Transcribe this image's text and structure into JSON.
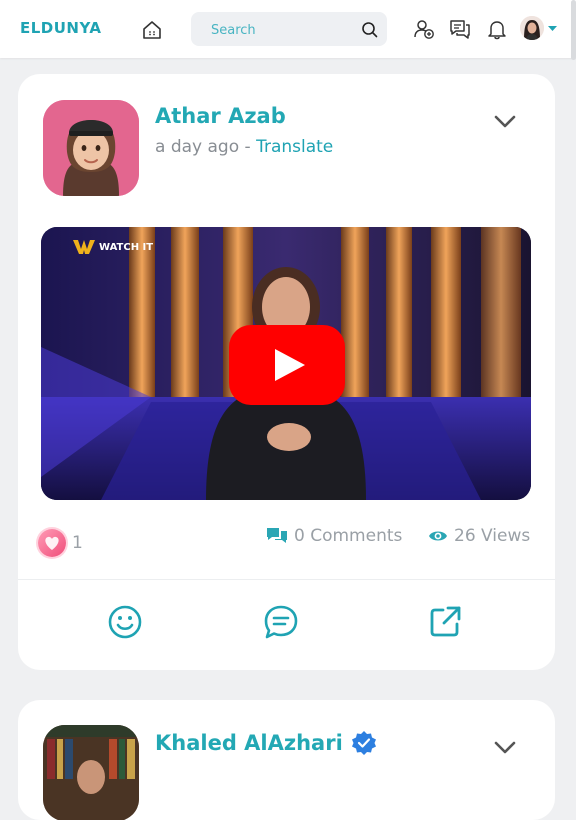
{
  "brand": {
    "logo_text": "ELDUNYA",
    "accent": "#1fa3b3",
    "like_color": "#f04d7a",
    "play_color": "#ff0000"
  },
  "topbar": {
    "search": {
      "placeholder": "Search"
    },
    "icons": [
      "home-icon",
      "search-icon",
      "add-friend-icon",
      "messages-icon",
      "bell-icon",
      "avatar",
      "chevron-down-icon"
    ]
  },
  "posts": [
    {
      "author": "Athar Azab",
      "time": "a day ago",
      "separator": " - ",
      "translate_label": "Translate",
      "video": {
        "channel_logo": "WATCH IT"
      },
      "likes": "1",
      "comments_label": "0 Comments",
      "views_label": "26 Views",
      "actions": [
        "emoji-react-icon",
        "comment-icon",
        "share-icon"
      ]
    },
    {
      "author": "Khaled AlAzhari",
      "verified": true
    }
  ]
}
